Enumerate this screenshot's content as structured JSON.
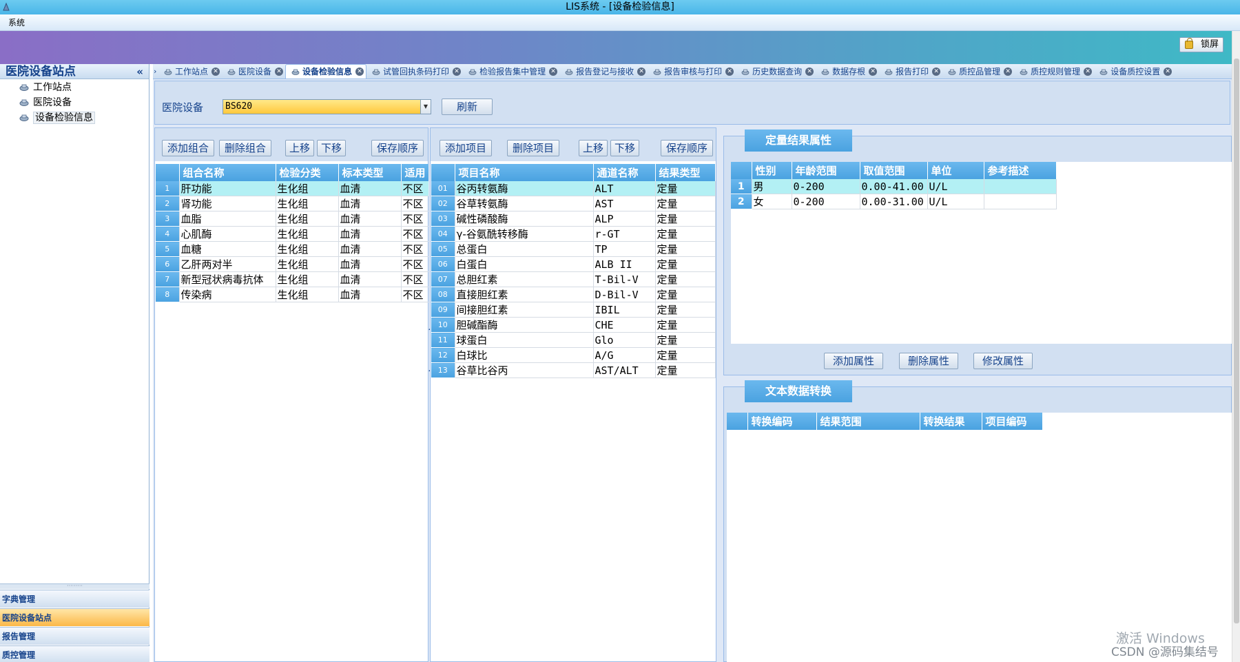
{
  "window": {
    "title": "LIS系统 - [设备检验信息]"
  },
  "menubar": {
    "items": [
      "系统"
    ]
  },
  "banner": {
    "lock_label": "锁屏"
  },
  "sidebar": {
    "title": "医院设备站点",
    "collapse_glyph": "«",
    "items": [
      {
        "label": "工作站点"
      },
      {
        "label": "医院设备"
      },
      {
        "label": "设备检验信息",
        "selected": true
      }
    ],
    "nav_groups": [
      {
        "label": "字典管理"
      },
      {
        "label": "医院设备站点",
        "active": true
      },
      {
        "label": "报告管理"
      },
      {
        "label": "质控管理"
      }
    ]
  },
  "tabs": [
    {
      "label": "工作站点"
    },
    {
      "label": "医院设备"
    },
    {
      "label": "设备检验信息",
      "active": true
    },
    {
      "label": "试管回执条码打印"
    },
    {
      "label": "检验报告集中管理"
    },
    {
      "label": "报告登记与接收"
    },
    {
      "label": "报告审核与打印"
    },
    {
      "label": "历史数据查询"
    },
    {
      "label": "数据存根"
    },
    {
      "label": "报告打印"
    },
    {
      "label": "质控品管理"
    },
    {
      "label": "质控规则管理"
    },
    {
      "label": "设备质控设置"
    }
  ],
  "device": {
    "label": "医院设备",
    "value": "BS620",
    "refresh_label": "刷新"
  },
  "groups_panel": {
    "buttons": {
      "add": "添加组合",
      "delete": "删除组合",
      "up": "上移",
      "down": "下移",
      "save": "保存顺序"
    },
    "columns": [
      "组合名称",
      "检验分类",
      "标本类型",
      "适用"
    ],
    "rows": [
      {
        "no": "1",
        "name": "肝功能",
        "category": "生化组",
        "specimen": "血清",
        "applies": "不区"
      },
      {
        "no": "2",
        "name": "肾功能",
        "category": "生化组",
        "specimen": "血清",
        "applies": "不区"
      },
      {
        "no": "3",
        "name": "血脂",
        "category": "生化组",
        "specimen": "血清",
        "applies": "不区"
      },
      {
        "no": "4",
        "name": "心肌酶",
        "category": "生化组",
        "specimen": "血清",
        "applies": "不区"
      },
      {
        "no": "5",
        "name": "血糖",
        "category": "生化组",
        "specimen": "血清",
        "applies": "不区"
      },
      {
        "no": "6",
        "name": "乙肝两对半",
        "category": "生化组",
        "specimen": "血清",
        "applies": "不区"
      },
      {
        "no": "7",
        "name": "新型冠状病毒抗体",
        "category": "生化组",
        "specimen": "血清",
        "applies": "不区"
      },
      {
        "no": "8",
        "name": "传染病",
        "category": "生化组",
        "specimen": "血清",
        "applies": "不区"
      }
    ]
  },
  "items_panel": {
    "buttons": {
      "add": "添加项目",
      "delete": "删除项目",
      "up": "上移",
      "down": "下移",
      "save": "保存顺序"
    },
    "columns": [
      "项目名称",
      "通道名称",
      "结果类型"
    ],
    "rows": [
      {
        "no": "01",
        "name": "谷丙转氨酶",
        "channel": "ALT",
        "type": "定量"
      },
      {
        "no": "02",
        "name": "谷草转氨酶",
        "channel": "AST",
        "type": "定量"
      },
      {
        "no": "03",
        "name": "碱性磷酸酶",
        "channel": "ALP",
        "type": "定量"
      },
      {
        "no": "04",
        "name": "γ-谷氨酰转移酶",
        "channel": "r-GT",
        "type": "定量"
      },
      {
        "no": "05",
        "name": "总蛋白",
        "channel": "TP",
        "type": "定量"
      },
      {
        "no": "06",
        "name": "白蛋白",
        "channel": "ALB II",
        "type": "定量"
      },
      {
        "no": "07",
        "name": "总胆红素",
        "channel": "T-Bil-V",
        "type": "定量"
      },
      {
        "no": "08",
        "name": "直接胆红素",
        "channel": "D-Bil-V",
        "type": "定量"
      },
      {
        "no": "09",
        "name": "间接胆红素",
        "channel": "IBIL",
        "type": "定量"
      },
      {
        "no": "10",
        "name": "胆碱酯酶",
        "channel": "CHE",
        "type": "定量"
      },
      {
        "no": "11",
        "name": "球蛋白",
        "channel": "Glo",
        "type": "定量"
      },
      {
        "no": "12",
        "name": "白球比",
        "channel": "A/G",
        "type": "定量"
      },
      {
        "no": "13",
        "name": "谷草比谷丙",
        "channel": "AST/ALT",
        "type": "定量"
      }
    ]
  },
  "quant_panel": {
    "title": "定量结果属性",
    "columns": [
      "性别",
      "年龄范围",
      "取值范围",
      "单位",
      "参考描述"
    ],
    "rows": [
      {
        "no": "1",
        "sex": "男",
        "age": "0-200",
        "range": "0.00-41.00",
        "unit": "U/L",
        "desc": ""
      },
      {
        "no": "2",
        "sex": "女",
        "age": "0-200",
        "range": "0.00-31.00",
        "unit": "U/L",
        "desc": ""
      }
    ],
    "buttons": {
      "add": "添加属性",
      "delete": "删除属性",
      "edit": "修改属性"
    }
  },
  "text_panel": {
    "title": "文本数据转换",
    "columns": [
      "转换编码",
      "结果范围",
      "转换结果",
      "项目编码"
    ]
  },
  "watermark": {
    "line1": "激活 Windows",
    "line2": "CSDN @源码集结号"
  }
}
